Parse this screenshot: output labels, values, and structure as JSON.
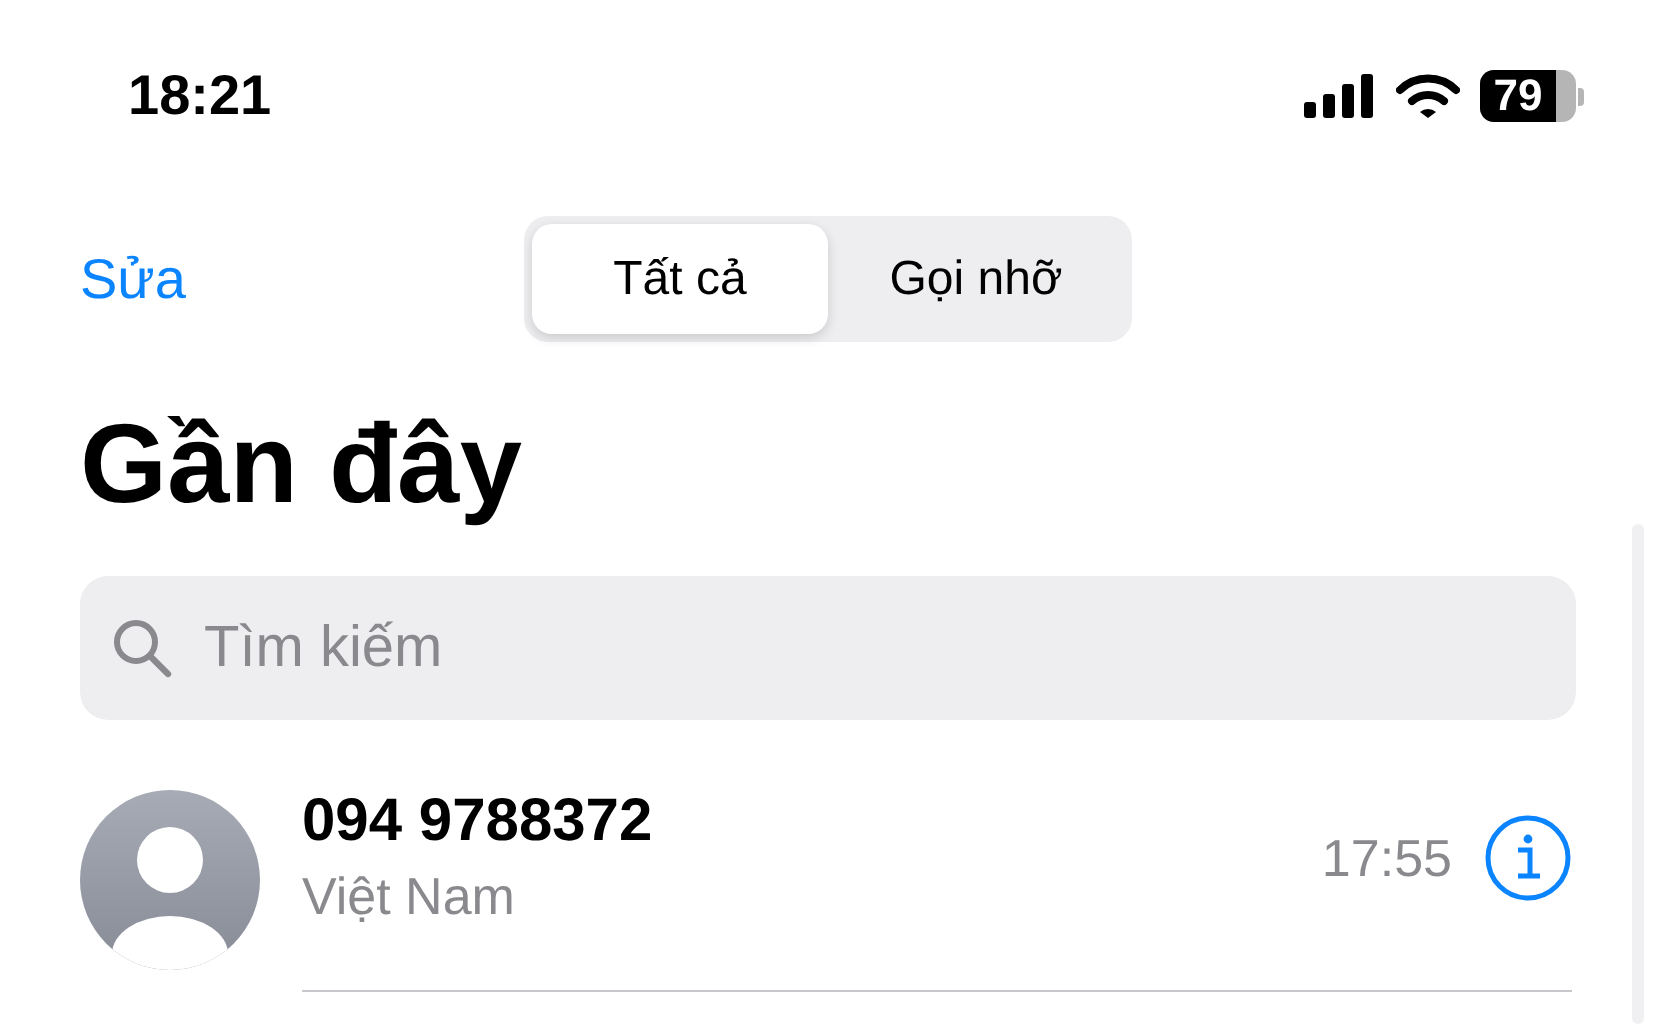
{
  "status_bar": {
    "time": "18:21",
    "battery": "79"
  },
  "nav": {
    "edit": "Sửa"
  },
  "segments": [
    {
      "label": "Tất cả",
      "selected": true
    },
    {
      "label": "Gọi nhỡ",
      "selected": false
    }
  ],
  "title": "Gần đây",
  "search": {
    "placeholder": "Tìm kiếm"
  },
  "calls": [
    {
      "name": "094 9788372",
      "subtitle": "Việt Nam",
      "time": "17:55"
    }
  ]
}
